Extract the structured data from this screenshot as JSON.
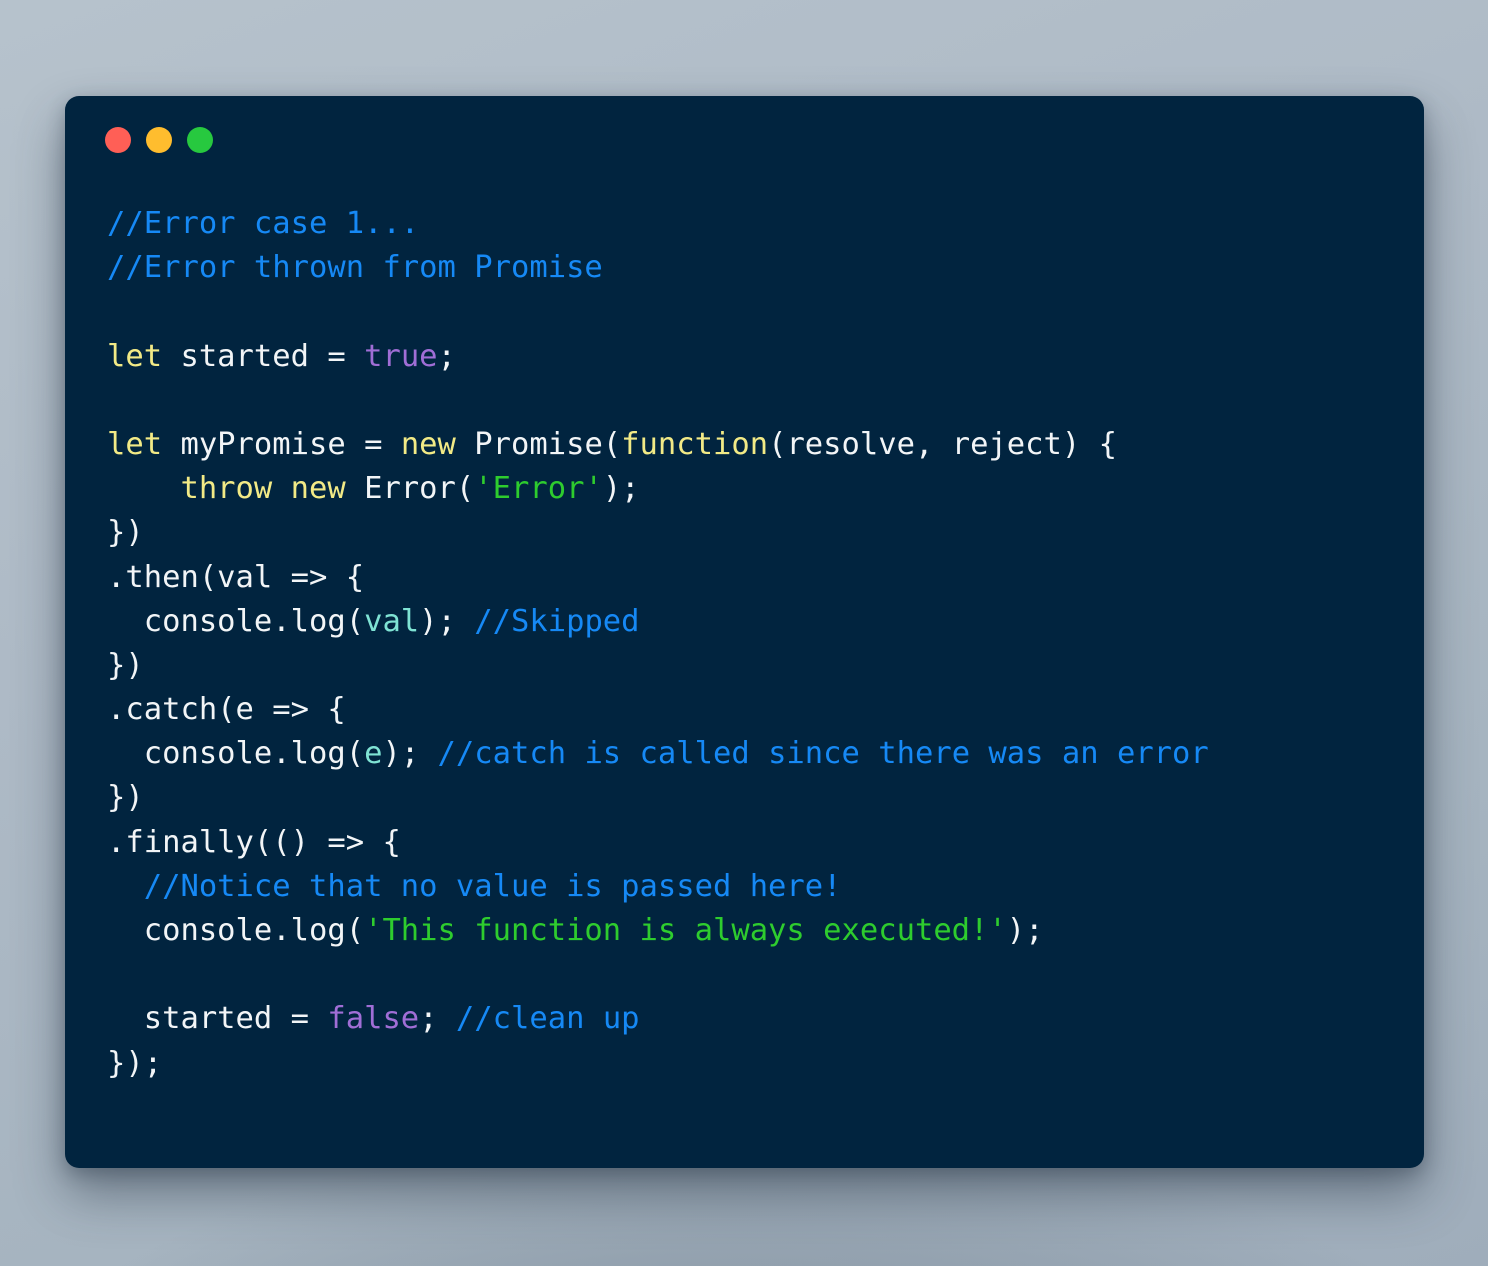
{
  "window": {
    "name": "code-snippet-window",
    "background_color": "#01243f",
    "page_background_color": "#aab8c2",
    "traffic_lights": [
      {
        "name": "close",
        "color": "#ff5f56"
      },
      {
        "name": "minimize",
        "color": "#ffbd2e"
      },
      {
        "name": "maximize",
        "color": "#27c93f"
      }
    ]
  },
  "theme": {
    "comment": "#1689f5",
    "keyword": "#f2ea86",
    "plain": "#f2f5f7",
    "string": "#2ecc2e",
    "boolean": "#a06ed6",
    "parameter": "#7fe3d4"
  },
  "code": {
    "language": "javascript",
    "plain_text": "//Error case 1...\n//Error thrown from Promise\n\nlet started = true;\n\nlet myPromise = new Promise(function(resolve, reject) {\n    throw new Error('Error');\n})\n.then(val => {\n  console.log(val); //Skipped\n})\n.catch(e => {\n  console.log(e); //catch is called since there was an error\n})\n.finally(() => {\n  //Notice that no value is passed here!\n  console.log('This function is always executed!');\n\n  started = false; //clean up\n});",
    "lines": [
      {
        "n": 1,
        "tokens": [
          {
            "t": "//Error case 1...",
            "c": "comment"
          }
        ]
      },
      {
        "n": 2,
        "tokens": [
          {
            "t": "//Error thrown from Promise",
            "c": "comment"
          }
        ]
      },
      {
        "n": 3,
        "tokens": []
      },
      {
        "n": 4,
        "tokens": [
          {
            "t": "let",
            "c": "keyword"
          },
          {
            "t": " started = ",
            "c": "plain"
          },
          {
            "t": "true",
            "c": "bool"
          },
          {
            "t": ";",
            "c": "plain"
          }
        ]
      },
      {
        "n": 5,
        "tokens": []
      },
      {
        "n": 6,
        "tokens": [
          {
            "t": "let",
            "c": "keyword"
          },
          {
            "t": " myPromise = ",
            "c": "plain"
          },
          {
            "t": "new",
            "c": "keyword"
          },
          {
            "t": " Promise(",
            "c": "plain"
          },
          {
            "t": "function",
            "c": "keyword"
          },
          {
            "t": "(resolve, reject) {",
            "c": "plain"
          }
        ]
      },
      {
        "n": 7,
        "tokens": [
          {
            "t": "    ",
            "c": "plain"
          },
          {
            "t": "throw new",
            "c": "keyword"
          },
          {
            "t": " Error(",
            "c": "plain"
          },
          {
            "t": "'Error'",
            "c": "string"
          },
          {
            "t": ");",
            "c": "plain"
          }
        ]
      },
      {
        "n": 8,
        "tokens": [
          {
            "t": "})",
            "c": "plain"
          }
        ]
      },
      {
        "n": 9,
        "tokens": [
          {
            "t": ".then(val => {",
            "c": "plain"
          }
        ]
      },
      {
        "n": 10,
        "tokens": [
          {
            "t": "  console.log(",
            "c": "plain"
          },
          {
            "t": "val",
            "c": "param"
          },
          {
            "t": "); ",
            "c": "plain"
          },
          {
            "t": "//Skipped",
            "c": "comment"
          }
        ]
      },
      {
        "n": 11,
        "tokens": [
          {
            "t": "})",
            "c": "plain"
          }
        ]
      },
      {
        "n": 12,
        "tokens": [
          {
            "t": ".catch(e => {",
            "c": "plain"
          }
        ]
      },
      {
        "n": 13,
        "tokens": [
          {
            "t": "  console.log(",
            "c": "plain"
          },
          {
            "t": "e",
            "c": "param"
          },
          {
            "t": "); ",
            "c": "plain"
          },
          {
            "t": "//catch is called since there was an error",
            "c": "comment"
          }
        ]
      },
      {
        "n": 14,
        "tokens": [
          {
            "t": "})",
            "c": "plain"
          }
        ]
      },
      {
        "n": 15,
        "tokens": [
          {
            "t": ".finally(() => {",
            "c": "plain"
          }
        ]
      },
      {
        "n": 16,
        "tokens": [
          {
            "t": "  ",
            "c": "plain"
          },
          {
            "t": "//Notice that no value is passed here!",
            "c": "comment"
          }
        ]
      },
      {
        "n": 17,
        "tokens": [
          {
            "t": "  console.log(",
            "c": "plain"
          },
          {
            "t": "'This function is always executed!'",
            "c": "string"
          },
          {
            "t": ");",
            "c": "plain"
          }
        ]
      },
      {
        "n": 18,
        "tokens": []
      },
      {
        "n": 19,
        "tokens": [
          {
            "t": "  started = ",
            "c": "plain"
          },
          {
            "t": "false",
            "c": "bool"
          },
          {
            "t": "; ",
            "c": "plain"
          },
          {
            "t": "//clean up",
            "c": "comment"
          }
        ]
      },
      {
        "n": 20,
        "tokens": [
          {
            "t": "});",
            "c": "plain"
          }
        ]
      }
    ]
  }
}
